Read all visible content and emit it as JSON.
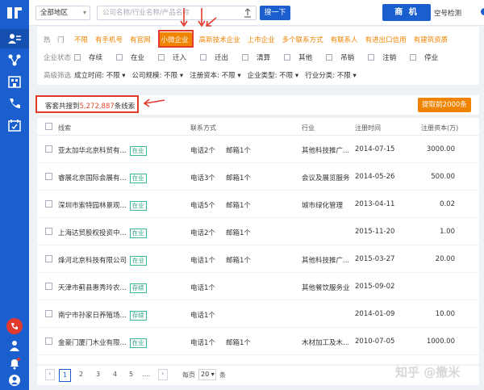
{
  "topbar": {
    "region": "全部地区",
    "search_placeholder": "公司名称/行业名称/产品名称",
    "search_button": "搜一下",
    "biz_button": "商 机",
    "empty_check_label": "空号检测"
  },
  "filters": {
    "hot_label": "热　门",
    "hot_tags": [
      "不限",
      "有手机号",
      "有官网",
      "小微企业",
      "高新技术企业",
      "上市企业",
      "多个联系方式",
      "有联系人",
      "有进出口信用",
      "有建筑资质"
    ],
    "selected_tag": "小微企业",
    "status_label": "企业状态",
    "statuses": [
      "存续",
      "在业",
      "迁入",
      "迁出",
      "清算",
      "其他",
      "吊销",
      "注销",
      "停业"
    ],
    "advanced_label": "高级筛选",
    "advanced": [
      "成立时间: 不限",
      "公司规模: 不限",
      "注册资本: 不限",
      "企业类型: 不限",
      "行业分类: 不限"
    ]
  },
  "results": {
    "prefix": "客套共搜到",
    "count": "5,272,887",
    "suffix": "条线索",
    "export_button": "提取前2000条"
  },
  "table": {
    "headers": [
      "线索",
      "联系方式",
      "行业",
      "注册时间",
      "注册资本(万)"
    ],
    "rows": [
      {
        "name": "亚太加华北京科贸有...",
        "status": "在业",
        "phone": "电话2个",
        "email": "邮箱1个",
        "industry": "其他科技推广...",
        "date": "2014-07-15",
        "capital": "3000.00"
      },
      {
        "name": "睿展北京国际会展有...",
        "status": "在业",
        "phone": "电话3个",
        "email": "邮箱1个",
        "industry": "会议及展览服务",
        "date": "2014-05-26",
        "capital": "500.00"
      },
      {
        "name": "深圳市索特园林景观...",
        "status": "在业",
        "phone": "电话5个",
        "email": "邮箱1个",
        "industry": "城市绿化管理",
        "date": "2013-04-11",
        "capital": "0.02"
      },
      {
        "name": "上海达贸股权投资中...",
        "status": "在业",
        "phone": "电话2个",
        "email": "邮箱1个",
        "industry": "",
        "date": "2015-11-20",
        "capital": "1.00"
      },
      {
        "name": "烽河北京科技有限公司",
        "status": "在业",
        "phone": "电话1个",
        "email": "邮箱1个",
        "industry": "其他科技推广...",
        "date": "2015-03-27",
        "capital": "20.00"
      },
      {
        "name": "天津市蓟县惠秀玲农...",
        "status": "存续",
        "phone": "电话1个",
        "email": "",
        "industry": "其他餐饮服务业",
        "date": "2015-09-02",
        "capital": ""
      },
      {
        "name": "南宁市孙家日养殖场...",
        "status": "存续",
        "phone": "电话1个",
        "email": "",
        "industry": "",
        "date": "2014-01-09",
        "capital": "10.00"
      },
      {
        "name": "金豪门厦门木业有限...",
        "status": "在业",
        "phone": "电话1个",
        "email": "邮箱1个",
        "industry": "木材加工及木...",
        "date": "2010-07-05",
        "capital": "1000.00"
      }
    ]
  },
  "pager": {
    "pages": [
      "1",
      "2",
      "3",
      "4",
      "5",
      "...."
    ],
    "per_page_label": "每页",
    "per_page": "20",
    "per_page_unit": "条"
  },
  "watermark": "知乎 @撒米"
}
